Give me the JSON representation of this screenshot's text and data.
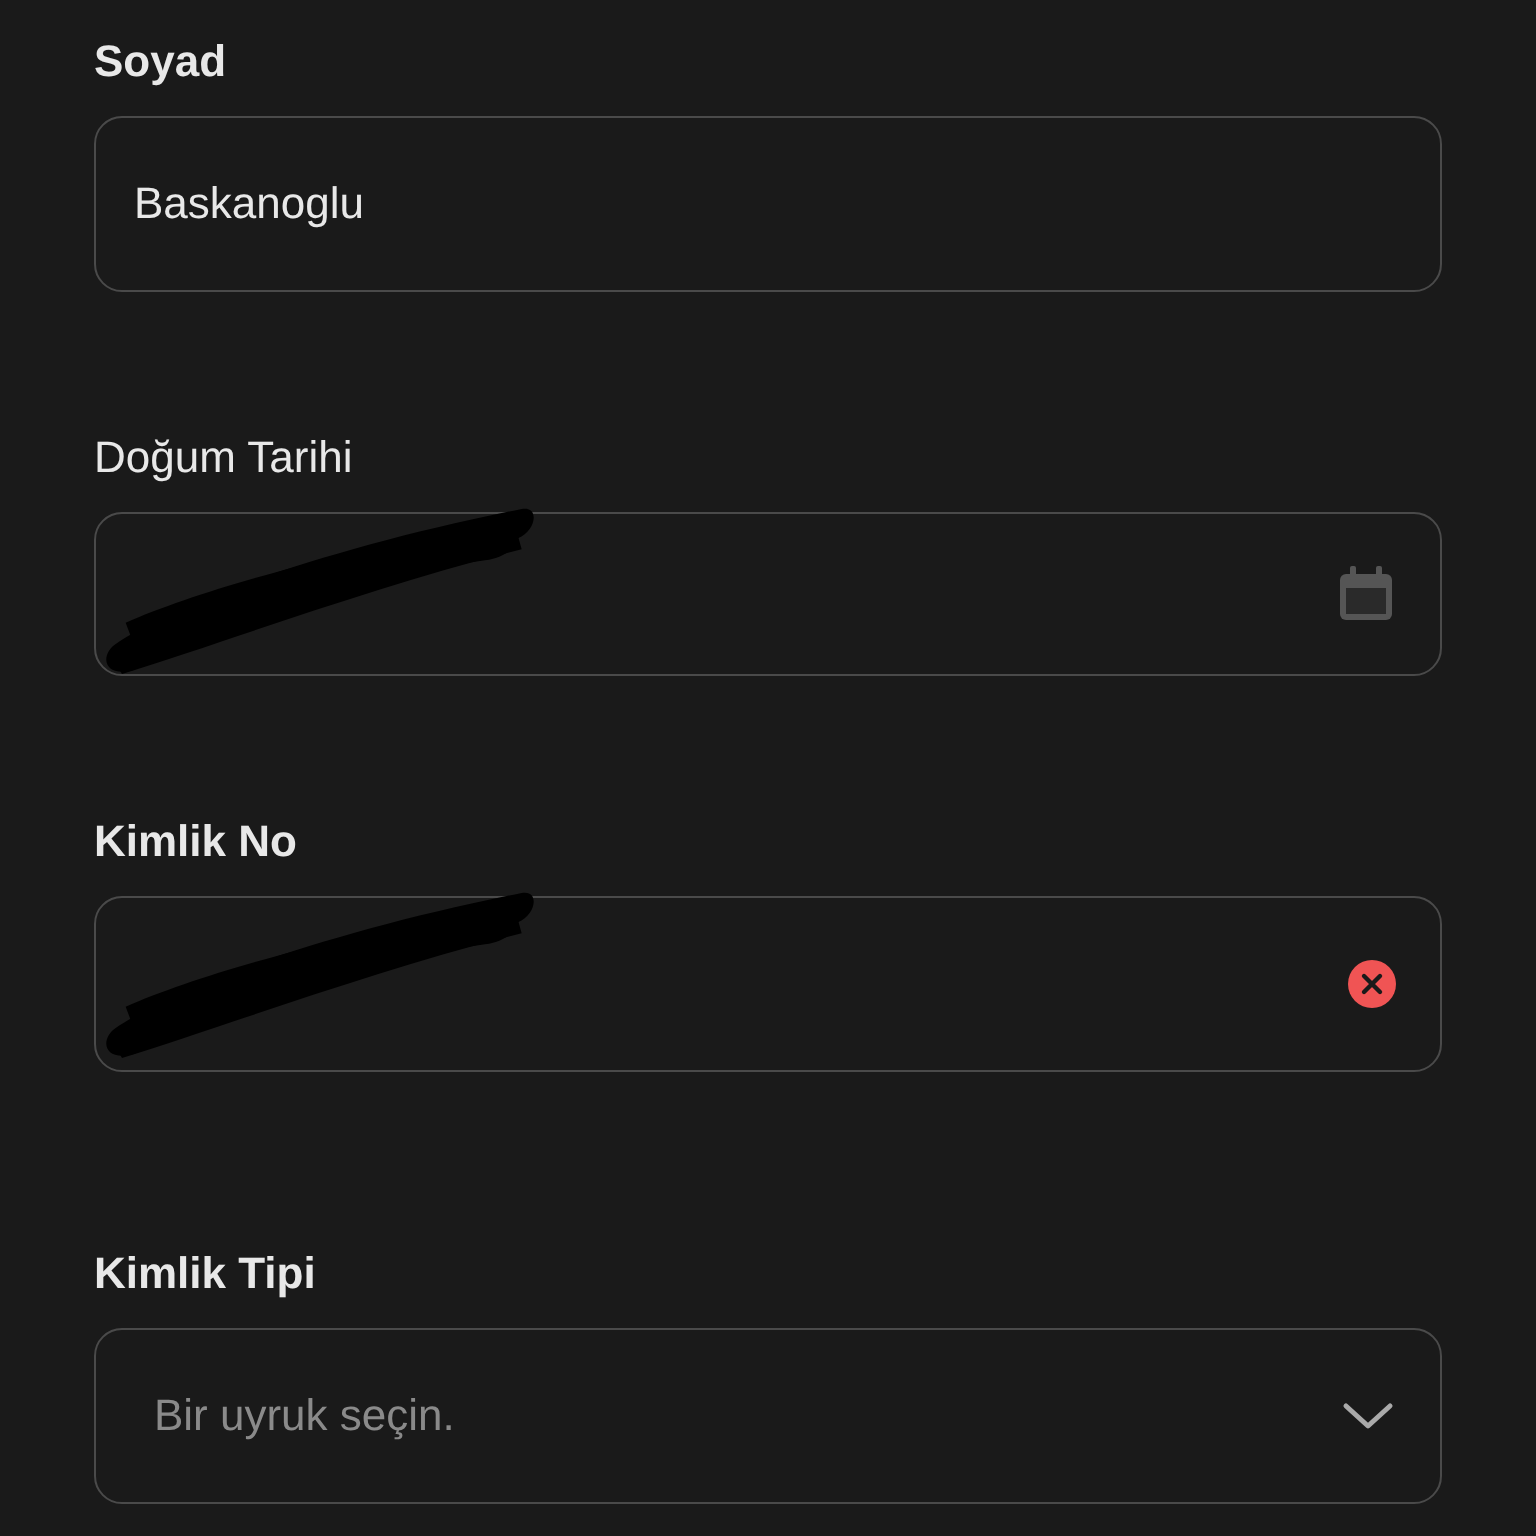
{
  "fields": [
    {
      "label": "Soyad",
      "kind": "text",
      "value": "Baskanoglu"
    },
    {
      "label": "Doğum Tarihi",
      "kind": "date",
      "redacted": true
    },
    {
      "label": "Kimlik No",
      "kind": "clearable",
      "redacted": true
    },
    {
      "label": "Kimlik Tipi",
      "kind": "select",
      "placeholder": "Bir uyruk seçin."
    }
  ]
}
